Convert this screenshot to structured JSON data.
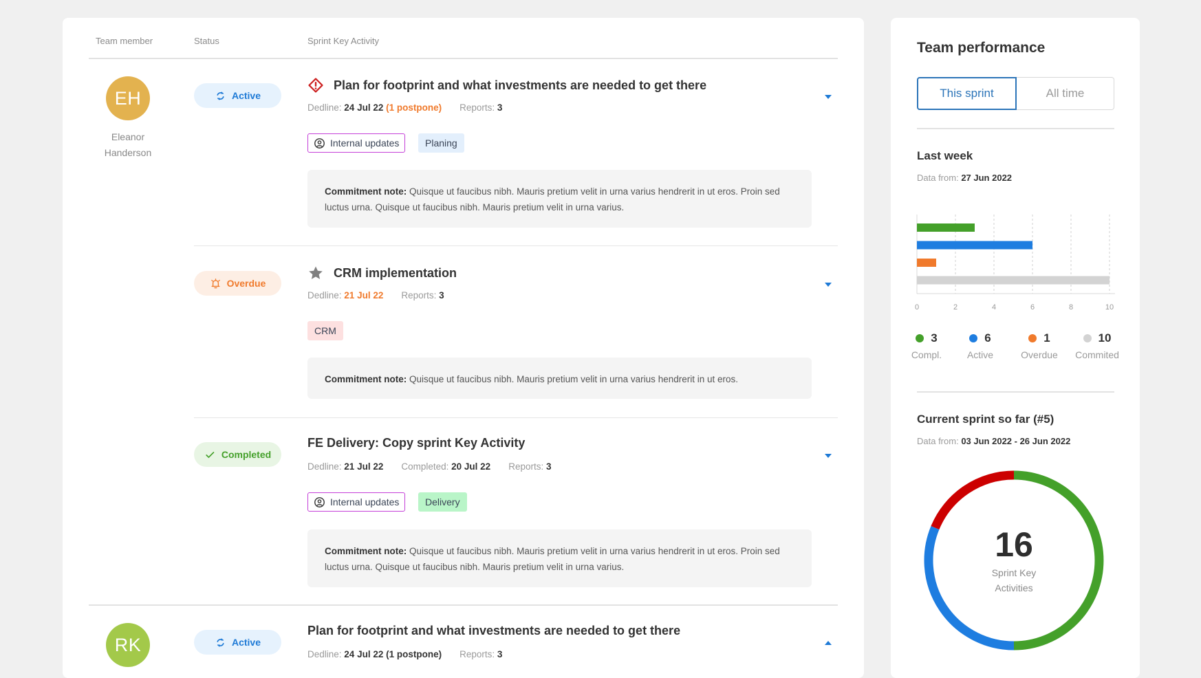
{
  "table": {
    "headers": {
      "member": "Team member",
      "status": "Status",
      "activity": "Sprint Key Activity"
    },
    "labels": {
      "deadline": "Dedline:",
      "reports": "Reports:",
      "completed": "Completed:",
      "note": "Commitment note:"
    },
    "members": [
      {
        "initials": "EH",
        "name_line1": "Eleanor",
        "name_line2": "Handerson",
        "avatar_color": "#e3b24f",
        "tasks": [
          {
            "status": "Active",
            "status_icon": "refresh-icon",
            "title": "Plan for footprint and what investments are needed to get there",
            "title_icon": "warning-diamond-icon",
            "deadline": "24 Jul 22",
            "postpone": "(1 postpone)",
            "reports": "3",
            "tags": [
              "Internal updates",
              "Planing"
            ],
            "note": "Quisque ut faucibus nibh. Mauris pretium velit in urna varius hendrerit in ut eros. Proin sed luctus urna. Quisque ut faucibus nibh. Mauris pretium velit in urna varius.",
            "expanded": true
          },
          {
            "status": "Overdue",
            "status_icon": "alarm-bell-icon",
            "title": "CRM implementation",
            "title_icon": "star-icon",
            "deadline": "21 Jul 22",
            "reports": "3",
            "tags": [
              "CRM"
            ],
            "note": "Quisque ut faucibus nibh. Mauris pretium velit in urna varius hendrerit in ut eros.",
            "expanded": true
          },
          {
            "status": "Completed",
            "status_icon": "check-icon",
            "title": "FE Delivery: Copy sprint Key Activity",
            "deadline": "21 Jul 22",
            "completed": "20 Jul 22",
            "reports": "3",
            "tags": [
              "Internal updates",
              "Delivery"
            ],
            "note": "Quisque ut faucibus nibh. Mauris pretium velit in urna varius hendrerit in ut eros. Proin sed luctus urna. Quisque ut faucibus nibh. Mauris pretium velit in urna varius.",
            "expanded": true
          }
        ]
      },
      {
        "initials": "RK",
        "avatar_color": "#a3c94a",
        "tasks": [
          {
            "status": "Active",
            "status_icon": "refresh-icon",
            "title": "Plan for footprint and what investments are needed to get there",
            "deadline": "24 Jul 22 (1 postpone)",
            "reports": "3",
            "expanded": false
          }
        ]
      }
    ]
  },
  "side": {
    "title": "Team performance",
    "toggle": {
      "active": "This sprint",
      "inactive": "All time"
    },
    "last_week": {
      "title": "Last week",
      "data_from_label": "Data from:",
      "data_from": "27 Jun 2022"
    },
    "current": {
      "title": "Current sprint so far (#5)",
      "data_from_label": "Data from:",
      "data_from": "03 Jun 2022 - 26 Jun 2022"
    },
    "legend": [
      {
        "value": "3",
        "label": "Compl.",
        "color": "#44a02a"
      },
      {
        "value": "6",
        "label": "Active",
        "color": "#1e7de0"
      },
      {
        "value": "1",
        "label": "Overdue",
        "color": "#f07a2c"
      },
      {
        "value": "10",
        "label": "Commited",
        "color": "#d3d3d3"
      }
    ],
    "donut_total": "16",
    "donut_label_1": "Sprint Key",
    "donut_label_2": "Activities"
  },
  "chart_data": [
    {
      "type": "bar",
      "orientation": "horizontal",
      "title": "Last week",
      "categories": [
        "Compl.",
        "Active",
        "Overdue",
        "Commited"
      ],
      "values": [
        3,
        6,
        1,
        10
      ],
      "colors": [
        "#44a02a",
        "#1e7de0",
        "#f07a2c",
        "#d3d3d3"
      ],
      "xlim": [
        0,
        10
      ],
      "xticks": [
        0,
        2,
        4,
        6,
        8,
        10
      ],
      "grid": "vertical-dashed"
    },
    {
      "type": "pie",
      "style": "donut",
      "title": "Current sprint so far (#5)",
      "total": 16,
      "categories": [
        "Completed",
        "Active",
        "Overdue"
      ],
      "values": [
        8,
        5,
        3
      ],
      "colors": [
        "#44a02a",
        "#1e7de0",
        "#cc0000"
      ]
    }
  ]
}
